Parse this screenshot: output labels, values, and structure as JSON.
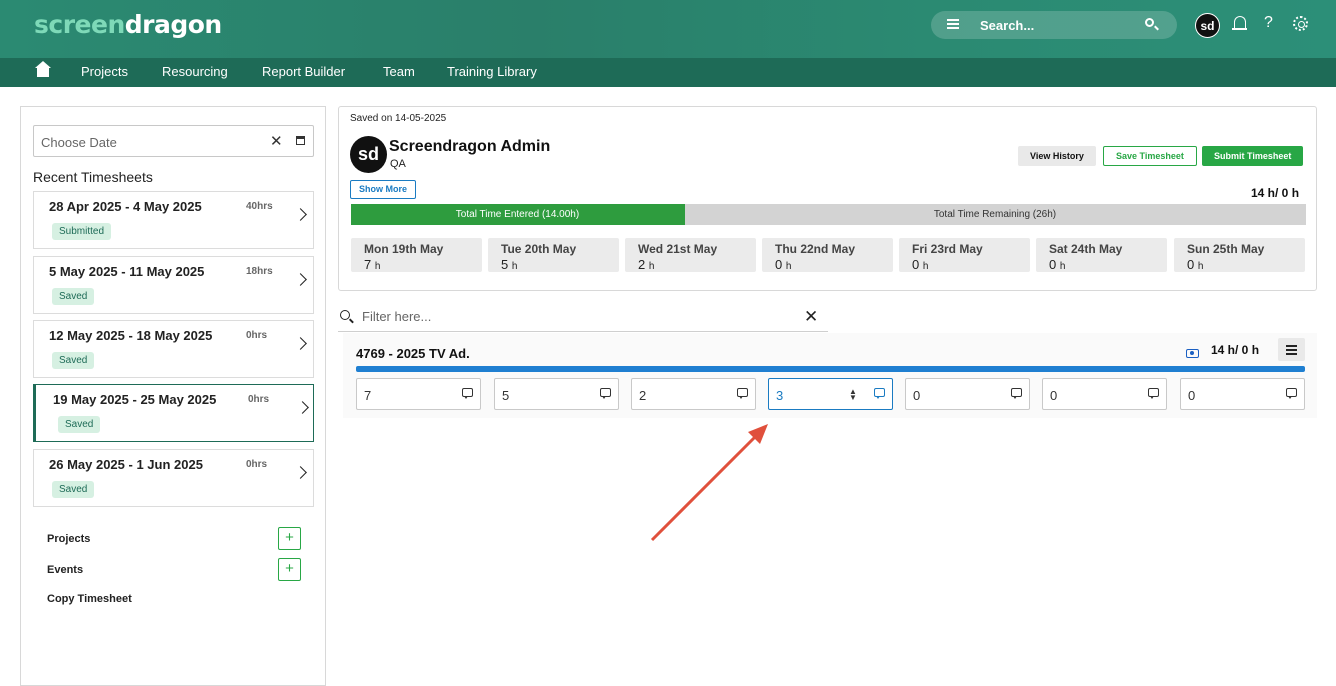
{
  "header": {
    "logo_part1": "screen",
    "logo_part2": "dragon",
    "search_placeholder": "Search...",
    "avatar_initials": "sd",
    "help_glyph": "?"
  },
  "nav": {
    "items": [
      "Projects",
      "Resourcing",
      "Report Builder",
      "Team",
      "Training Library"
    ]
  },
  "left": {
    "date_placeholder": "Choose Date",
    "recent_heading": "Recent Timesheets",
    "timesheets": [
      {
        "range": "28 Apr 2025 - 4 May 2025",
        "hours": "40hrs",
        "status": "Submitted"
      },
      {
        "range": "5 May 2025 - 11 May 2025",
        "hours": "18hrs",
        "status": "Saved"
      },
      {
        "range": "12 May 2025 - 18 May 2025",
        "hours": "0hrs",
        "status": "Saved"
      },
      {
        "range": "19 May 2025 - 25 May 2025",
        "hours": "0hrs",
        "status": "Saved"
      },
      {
        "range": "26 May 2025 - 1 Jun 2025",
        "hours": "0hrs",
        "status": "Saved"
      }
    ],
    "links": {
      "projects": "Projects",
      "events": "Events",
      "copy": "Copy Timesheet"
    }
  },
  "main": {
    "saved_on": "Saved on 14-05-2025",
    "avatar_initials": "sd",
    "user_name": "Screendragon Admin",
    "user_role": "QA",
    "show_more": "Show More",
    "buttons": {
      "history": "View History",
      "save": "Save Timesheet",
      "submit": "Submit Timesheet"
    },
    "total_hours": "14 h/ 0 h",
    "progress": {
      "entered_label": "Total Time Entered (14.00h)",
      "remaining_label": "Total Time Remaining (26h)",
      "entered_fraction": 0.35
    },
    "days": [
      {
        "name": "Mon 19th May",
        "hours": "7"
      },
      {
        "name": "Tue 20th May",
        "hours": "5"
      },
      {
        "name": "Wed 21st May",
        "hours": "2"
      },
      {
        "name": "Thu 22nd May",
        "hours": "0"
      },
      {
        "name": "Fri 23rd May",
        "hours": "0"
      },
      {
        "name": "Sat 24th May",
        "hours": "0"
      },
      {
        "name": "Sun 25th May",
        "hours": "0"
      }
    ],
    "hours_unit": "h"
  },
  "filter": {
    "placeholder": "Filter here..."
  },
  "project": {
    "name": "4769 - 2025 TV Ad.",
    "hours": "14 h/ 0 h",
    "entries": [
      "7",
      "5",
      "2",
      "3",
      "0",
      "0",
      "0"
    ]
  },
  "colors": {
    "header_green": "#2b8a72",
    "nav_green": "#1e6b57",
    "progress_green": "#2e9c3e",
    "project_bar_blue": "#1f7fd1",
    "annotation_arrow": "#e0503c"
  }
}
